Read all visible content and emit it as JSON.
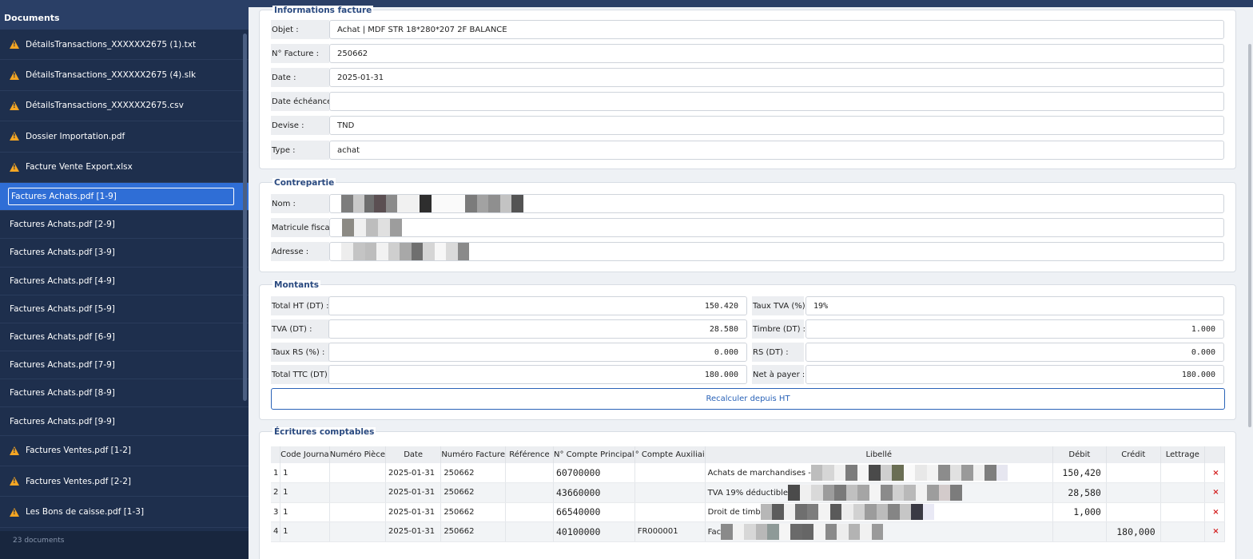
{
  "sidebar": {
    "title": "Documents",
    "items": [
      {
        "label": "DétailsTransactions_XXXXXX2675 (1).txt",
        "warn": true
      },
      {
        "label": "DétailsTransactions_XXXXXX2675 (4).slk",
        "warn": true
      },
      {
        "label": "DétailsTransactions_XXXXXX2675.csv",
        "warn": true
      },
      {
        "label": "Dossier Importation.pdf",
        "warn": true
      },
      {
        "label": "Facture Vente Export.xlsx",
        "warn": true
      },
      {
        "label": "Factures Achats.pdf [1-9]",
        "warn": false,
        "selected": true
      },
      {
        "label": "Factures Achats.pdf [2-9]",
        "warn": false
      },
      {
        "label": "Factures Achats.pdf [3-9]",
        "warn": false
      },
      {
        "label": "Factures Achats.pdf [4-9]",
        "warn": false
      },
      {
        "label": "Factures Achats.pdf [5-9]",
        "warn": false
      },
      {
        "label": "Factures Achats.pdf [6-9]",
        "warn": false
      },
      {
        "label": "Factures Achats.pdf [7-9]",
        "warn": false
      },
      {
        "label": "Factures Achats.pdf [8-9]",
        "warn": false
      },
      {
        "label": "Factures Achats.pdf [9-9]",
        "warn": false
      },
      {
        "label": "Factures Ventes.pdf [1-2]",
        "warn": true
      },
      {
        "label": "Factures Ventes.pdf [2-2]",
        "warn": true
      },
      {
        "label": "Les Bons de caisse.pdf [1-3]",
        "warn": true
      }
    ],
    "footer": "23 documents",
    "warn_icon": "warning-icon",
    "accent": "#2f6ed6"
  },
  "facture": {
    "title": "Informations facture",
    "objet_label": "Objet :",
    "objet": "Achat | MDF STR 18*280*207 2F BALANCE",
    "numero_label": "N° Facture :",
    "numero": "250662",
    "date_label": "Date :",
    "date": "2025-01-31",
    "echeance_label": "Date échéance :",
    "echeance": "",
    "devise_label": "Devise :",
    "devise": "TND",
    "type_label": "Type :",
    "type": "achat"
  },
  "contrepartie": {
    "title": "Contrepartie",
    "nom_label": "Nom :",
    "matricule_label": "Matricule fiscal :",
    "adresse_label": "Adresse :"
  },
  "montants": {
    "title": "Montants",
    "total_ht_label": "Total HT (DT) :",
    "total_ht": "150.420",
    "taux_tva_label": "Taux TVA (%) :",
    "taux_tva": "19%",
    "tva_label": "TVA (DT) :",
    "tva": "28.580",
    "timbre_label": "Timbre (DT) :",
    "timbre": "1.000",
    "taux_rs_label": "Taux RS (%) :",
    "taux_rs": "0.000",
    "rs_label": "RS (DT) :",
    "rs": "0.000",
    "total_ttc_label": "Total TTC (DT) :",
    "total_ttc": "180.000",
    "net_label": "Net à payer :",
    "net": "180.000",
    "recalc_label": "Recalculer depuis HT"
  },
  "ecritures": {
    "title": "Écritures comptables",
    "columns": [
      "",
      "Code Journa",
      "Numéro Pièce",
      "Date",
      "Numéro Facture",
      "Référence",
      "N° Compte Principal",
      "° Compte Auxiliai",
      "Libellé",
      "Débit",
      "Crédit",
      "Lettrage",
      ""
    ],
    "rows": [
      {
        "n": "1",
        "journal": "1",
        "piece": "",
        "date": "2025-01-31",
        "facture": "250662",
        "ref": "",
        "compte": "60700000",
        "aux": "",
        "libelle": "Achats de marchandises -",
        "debit": "150,420",
        "credit": "",
        "lettrage": ""
      },
      {
        "n": "2",
        "journal": "1",
        "piece": "",
        "date": "2025-01-31",
        "facture": "250662",
        "ref": "",
        "compte": "43660000",
        "aux": "",
        "libelle": "TVA 19% déductible",
        "debit": "28,580",
        "credit": "",
        "lettrage": ""
      },
      {
        "n": "3",
        "journal": "1",
        "piece": "",
        "date": "2025-01-31",
        "facture": "250662",
        "ref": "",
        "compte": "66540000",
        "aux": "",
        "libelle": "Droit de timb",
        "debit": "1,000",
        "credit": "",
        "lettrage": ""
      },
      {
        "n": "4",
        "journal": "1",
        "piece": "",
        "date": "2025-01-31",
        "facture": "250662",
        "ref": "",
        "compte": "40100000",
        "aux": "FR000001",
        "libelle": "Fac",
        "debit": "",
        "credit": "180,000",
        "lettrage": ""
      }
    ],
    "delete_glyph": "×"
  }
}
